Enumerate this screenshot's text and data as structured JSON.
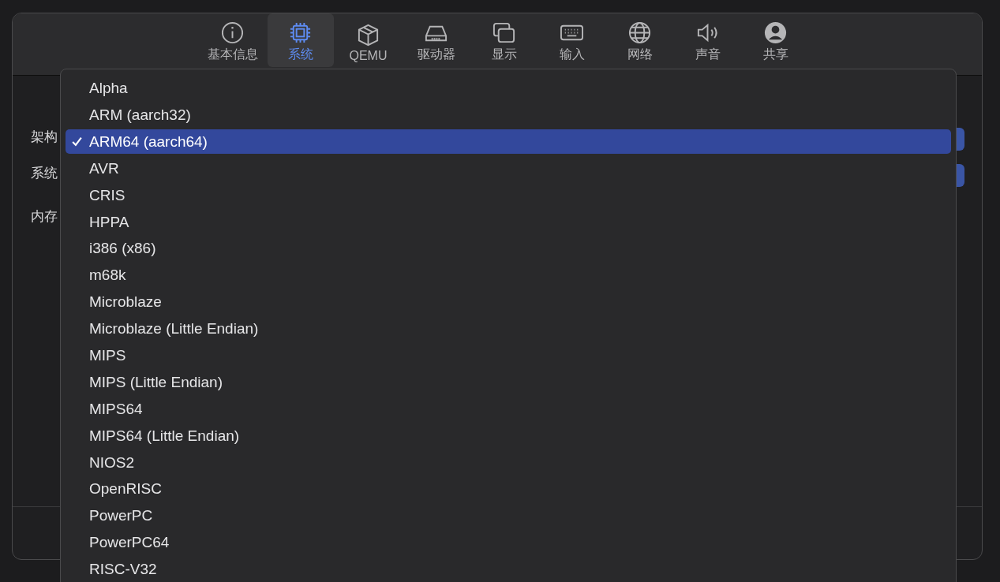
{
  "toolbar": {
    "tabs": [
      {
        "kind": "info",
        "label": "基本信息",
        "selected": false
      },
      {
        "kind": "chip",
        "label": "系统",
        "selected": true
      },
      {
        "kind": "cube",
        "label": "QEMU",
        "selected": false
      },
      {
        "kind": "drive",
        "label": "驱动器",
        "selected": false
      },
      {
        "kind": "display",
        "label": "显示",
        "selected": false
      },
      {
        "kind": "keyboard",
        "label": "输入",
        "selected": false
      },
      {
        "kind": "globe",
        "label": "网络",
        "selected": false
      },
      {
        "kind": "speaker",
        "label": "声音",
        "selected": false
      },
      {
        "kind": "person",
        "label": "共享",
        "selected": false
      }
    ]
  },
  "form": {
    "labels": [
      "架构",
      "系统",
      "内存"
    ]
  },
  "architecture_menu": {
    "items": [
      {
        "label": "Alpha",
        "selected": false
      },
      {
        "label": "ARM (aarch32)",
        "selected": false
      },
      {
        "label": "ARM64 (aarch64)",
        "selected": true
      },
      {
        "label": "AVR",
        "selected": false
      },
      {
        "label": "CRIS",
        "selected": false
      },
      {
        "label": "HPPA",
        "selected": false
      },
      {
        "label": "i386 (x86)",
        "selected": false
      },
      {
        "label": "m68k",
        "selected": false
      },
      {
        "label": "Microblaze",
        "selected": false
      },
      {
        "label": "Microblaze (Little Endian)",
        "selected": false
      },
      {
        "label": "MIPS",
        "selected": false
      },
      {
        "label": "MIPS (Little Endian)",
        "selected": false
      },
      {
        "label": "MIPS64",
        "selected": false
      },
      {
        "label": "MIPS64 (Little Endian)",
        "selected": false
      },
      {
        "label": "NIOS2",
        "selected": false
      },
      {
        "label": "OpenRISC",
        "selected": false
      },
      {
        "label": "PowerPC",
        "selected": false
      },
      {
        "label": "PowerPC64",
        "selected": false
      },
      {
        "label": "RISC-V32",
        "selected": false
      }
    ]
  }
}
